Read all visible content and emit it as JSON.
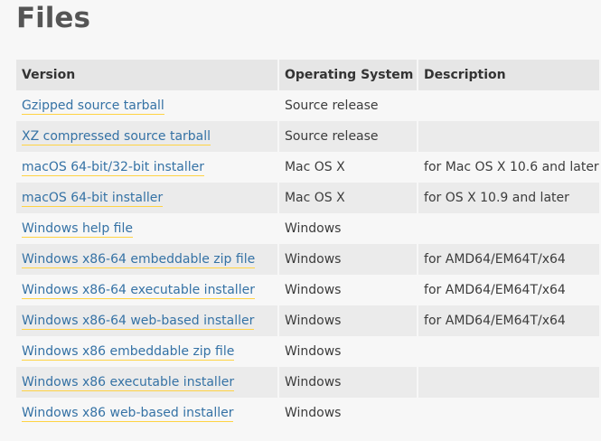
{
  "title": "Files",
  "table": {
    "headers": {
      "version": "Version",
      "os": "Operating System",
      "description": "Description"
    },
    "rows": [
      {
        "version": "Gzipped source tarball",
        "os": "Source release",
        "description": ""
      },
      {
        "version": "XZ compressed source tarball",
        "os": "Source release",
        "description": ""
      },
      {
        "version": "macOS 64-bit/32-bit installer",
        "os": "Mac OS X",
        "description": "for Mac OS X 10.6 and later"
      },
      {
        "version": "macOS 64-bit installer",
        "os": "Mac OS X",
        "description": "for OS X 10.9 and later"
      },
      {
        "version": "Windows help file",
        "os": "Windows",
        "description": ""
      },
      {
        "version": "Windows x86-64 embeddable zip file",
        "os": "Windows",
        "description": "for AMD64/EM64T/x64"
      },
      {
        "version": "Windows x86-64 executable installer",
        "os": "Windows",
        "description": "for AMD64/EM64T/x64"
      },
      {
        "version": "Windows x86-64 web-based installer",
        "os": "Windows",
        "description": "for AMD64/EM64T/x64"
      },
      {
        "version": "Windows x86 embeddable zip file",
        "os": "Windows",
        "description": ""
      },
      {
        "version": "Windows x86 executable installer",
        "os": "Windows",
        "description": ""
      },
      {
        "version": "Windows x86 web-based installer",
        "os": "Windows",
        "description": ""
      }
    ]
  },
  "colors": {
    "link": "#3572a5",
    "link_underline": "#ffd343",
    "header_bg": "#e6e6e6",
    "stripe_bg": "#ebebeb",
    "page_bg": "#f7f7f7"
  }
}
